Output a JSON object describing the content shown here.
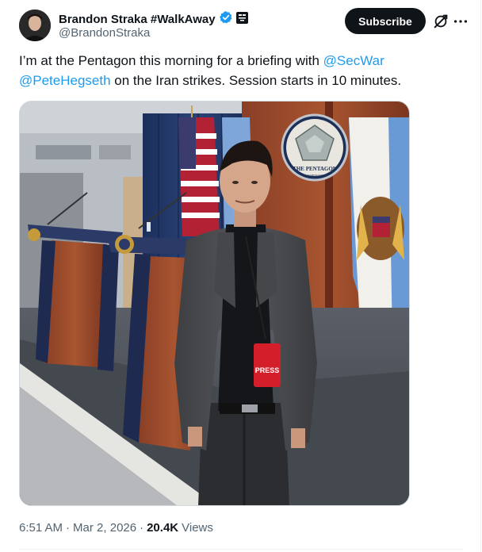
{
  "author": {
    "display_name": "Brandon Straka #WalkAway",
    "handle": "@BrandonStraka"
  },
  "actions": {
    "subscribe_label": "Subscribe",
    "grok_icon": "grok-icon",
    "more_icon": "more-icon"
  },
  "tweet": {
    "text_1": "I’m at the Pentagon this morning for a briefing with ",
    "mention_1": "@SecWar",
    "mention_2": "@PeteHegseth",
    "text_2": " on the Iran strikes. Session starts in 10 minutes."
  },
  "photo": {
    "seal_text_1": "THE PENTAGON",
    "seal_text_2": "WASHINGTON",
    "badge_text": "PRESS"
  },
  "meta": {
    "time": "6:51 AM",
    "date": "Mar 2, 2026",
    "views_count": "20.4K",
    "views_label": "Views"
  },
  "colors": {
    "accent": "#1d9bf0",
    "verified_badge": "#1d9bf0",
    "text_primary": "#0f1419",
    "text_secondary": "#536471"
  }
}
